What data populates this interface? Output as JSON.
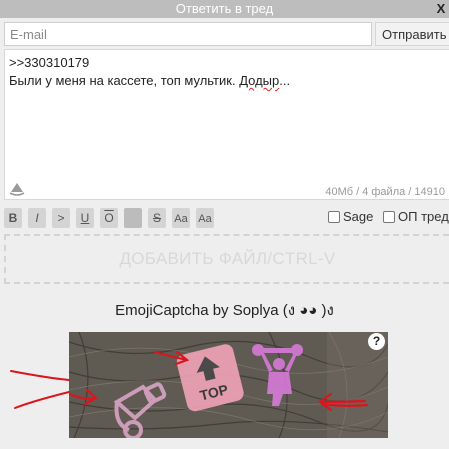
{
  "window": {
    "title": "Ответить в тред",
    "close_label": "X"
  },
  "form": {
    "email_placeholder": "E-mail",
    "submit_label": "Отправить",
    "message_line1": ">>330310179",
    "message_line2_before": "Были у меня на кассете, топ мультик. ",
    "message_line2_misspelled": "Додыр",
    "message_line2_after": "...",
    "status": "40Мб / 4 файла / 14910"
  },
  "toolbar": {
    "buttons": [
      {
        "label": "B",
        "icon": "bold-icon"
      },
      {
        "label": "I",
        "icon": "italic-icon"
      },
      {
        "label": ">",
        "icon": "quote-icon"
      },
      {
        "label": "U",
        "icon": "underline-icon"
      },
      {
        "label": "O",
        "icon": "overline-icon"
      },
      {
        "label": "",
        "icon": "spoiler-icon"
      },
      {
        "label": "S",
        "icon": "strikethrough-icon"
      },
      {
        "label": "Aa",
        "icon": "superscript-icon"
      },
      {
        "label": "Aa",
        "icon": "subscript-icon"
      }
    ],
    "sage_label": "Sage",
    "op_label": "ОП треда"
  },
  "dropzone": {
    "label": "ДОБАВИТЬ ФАЙЛ/CTRL-V"
  },
  "captcha": {
    "title": "EmojiCaptcha by Soplya (ง ◕◕ )ง",
    "emoji_top_text": "TOP",
    "help_label": "?",
    "colors": {
      "background": "#5f5a52",
      "top_sign": "#f1a3b8",
      "figure": "#d77ad8",
      "arrow": "#d9161e"
    }
  }
}
